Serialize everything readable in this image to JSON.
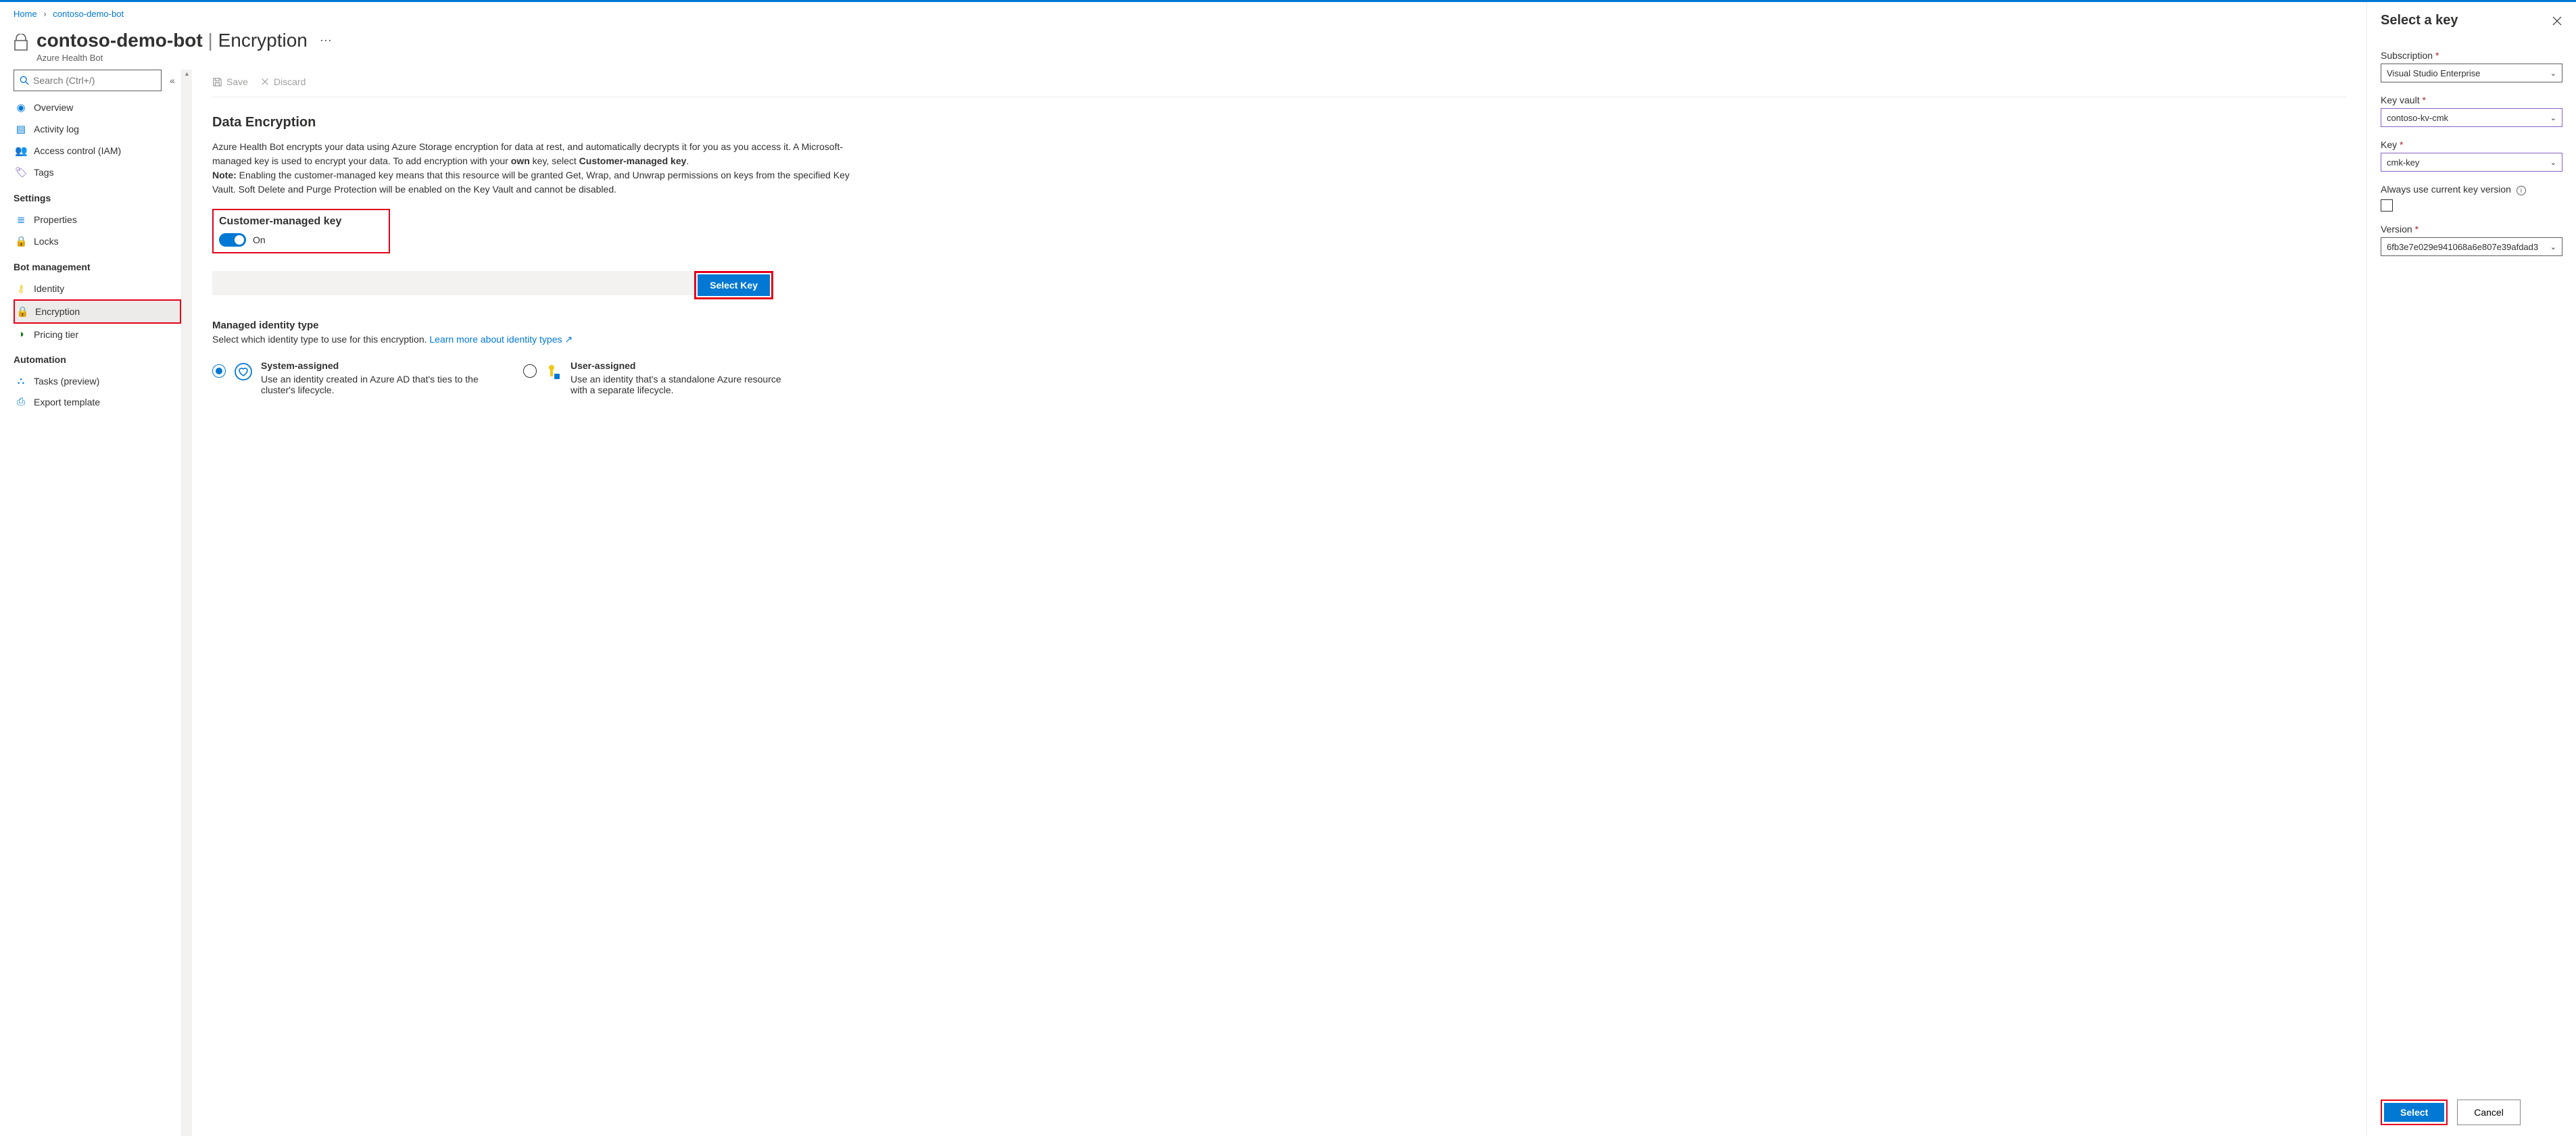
{
  "breadcrumb": {
    "home": "Home",
    "resource": "contoso-demo-bot"
  },
  "header": {
    "title_left": "contoso-demo-bot",
    "title_right": "Encryption",
    "subtitle": "Azure Health Bot"
  },
  "search": {
    "placeholder": "Search (Ctrl+/)"
  },
  "nav": {
    "overview": "Overview",
    "activity_log": "Activity log",
    "access_control": "Access control (IAM)",
    "tags": "Tags",
    "settings_heading": "Settings",
    "properties": "Properties",
    "locks": "Locks",
    "bot_heading": "Bot management",
    "identity": "Identity",
    "encryption": "Encryption",
    "pricing": "Pricing tier",
    "automation_heading": "Automation",
    "tasks": "Tasks (preview)",
    "export_template": "Export template"
  },
  "toolbar": {
    "save": "Save",
    "discard": "Discard"
  },
  "content": {
    "title": "Data Encryption",
    "desc_1": "Azure Health Bot encrypts your data using Azure Storage encryption for data at rest, and automatically decrypts it for you as you access it. A Microsoft-managed key is used to encrypt your data. To add encryption with your ",
    "desc_own": "own",
    "desc_2": " key, select ",
    "desc_cmk": "Customer-managed key",
    "desc_3": ".",
    "note_label": "Note:",
    "note_text": " Enabling the customer-managed key means that this resource will be granted Get, Wrap, and Unwrap permissions on keys from the specified Key Vault. Soft Delete and Purge Protection will be enabled on the Key Vault and cannot be disabled.",
    "cmk_title": "Customer-managed key",
    "toggle_label": "On",
    "select_key_btn": "Select Key",
    "identity_title": "Managed identity type",
    "identity_desc": "Select which identity type to use for this encryption. ",
    "identity_link": "Learn more about identity types",
    "opt1_title": "System-assigned",
    "opt1_desc": "Use an identity created in Azure AD that's ties to the cluster's lifecycle.",
    "opt2_title": "User-assigned",
    "opt2_desc": "Use an identity that's a standalone Azure resource with a separate lifecycle."
  },
  "panel": {
    "title": "Select a key",
    "subscription_label": "Subscription",
    "subscription_value": "Visual Studio Enterprise",
    "keyvault_label": "Key vault",
    "keyvault_value": "contoso-kv-cmk",
    "key_label": "Key",
    "key_value": "cmk-key",
    "always_current_label": "Always use current key version",
    "version_label": "Version",
    "version_value": "6fb3e7e029e941068a6e807e39afdad3",
    "select_btn": "Select",
    "cancel_btn": "Cancel"
  }
}
